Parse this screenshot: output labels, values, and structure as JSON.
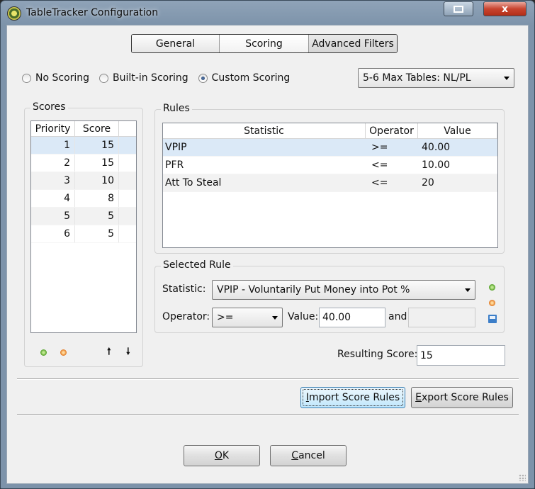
{
  "window": {
    "title": "TableTracker Configuration",
    "close_glyph": "x"
  },
  "tabs": [
    {
      "label": "General"
    },
    {
      "label": "Scoring"
    },
    {
      "label": "Advanced Filters"
    }
  ],
  "scoring_mode": {
    "options": [
      "No Scoring",
      "Built-in Scoring",
      "Custom Scoring"
    ],
    "selected": "Custom Scoring"
  },
  "table_type_select": {
    "value": "5-6 Max Tables: NL/PL"
  },
  "scores": {
    "label": "Scores",
    "columns": [
      "Priority",
      "Score"
    ],
    "rows": [
      {
        "priority": "1",
        "score": "15"
      },
      {
        "priority": "2",
        "score": "15"
      },
      {
        "priority": "3",
        "score": "10"
      },
      {
        "priority": "4",
        "score": "8"
      },
      {
        "priority": "5",
        "score": "5"
      },
      {
        "priority": "6",
        "score": "5"
      }
    ],
    "move_up_glyph": "🠕",
    "move_down_glyph": "🠗"
  },
  "rules": {
    "label": "Rules",
    "columns": [
      "Statistic",
      "Operator",
      "Value"
    ],
    "rows": [
      {
        "statistic": "VPIP",
        "operator": ">=",
        "value": "40.00"
      },
      {
        "statistic": "PFR",
        "operator": "<=",
        "value": "10.00"
      },
      {
        "statistic": "Att To Steal",
        "operator": "<=",
        "value": "20"
      }
    ]
  },
  "selected_rule": {
    "label": "Selected Rule",
    "statistic_label": "Statistic:",
    "statistic_value": "VPIP - Voluntarily Put Money into Pot %",
    "operator_label": "Operator:",
    "operator_value": ">=",
    "value_label": "Value:",
    "value": "40.00",
    "and_label": "and",
    "and_value": ""
  },
  "resulting_score": {
    "label": "Resulting Score:",
    "value": "15"
  },
  "buttons": {
    "import_prefix": "I",
    "import_rest": "mport Score Rules",
    "export_prefix": "E",
    "export_rest": "xport Score Rules",
    "ok_prefix": "O",
    "ok_rest": "K",
    "cancel_prefix": "C",
    "cancel_rest": "ancel"
  },
  "colors": {
    "selection": "#dbe9f7",
    "close_button": "#c8442f",
    "titlebar": "#8fa3b8"
  },
  "icons": [
    "app-icon",
    "restore-icon",
    "close-icon",
    "add-icon",
    "remove-icon",
    "arrow-up-icon",
    "arrow-down-icon",
    "save-icon",
    "chevron-down-icon"
  ]
}
